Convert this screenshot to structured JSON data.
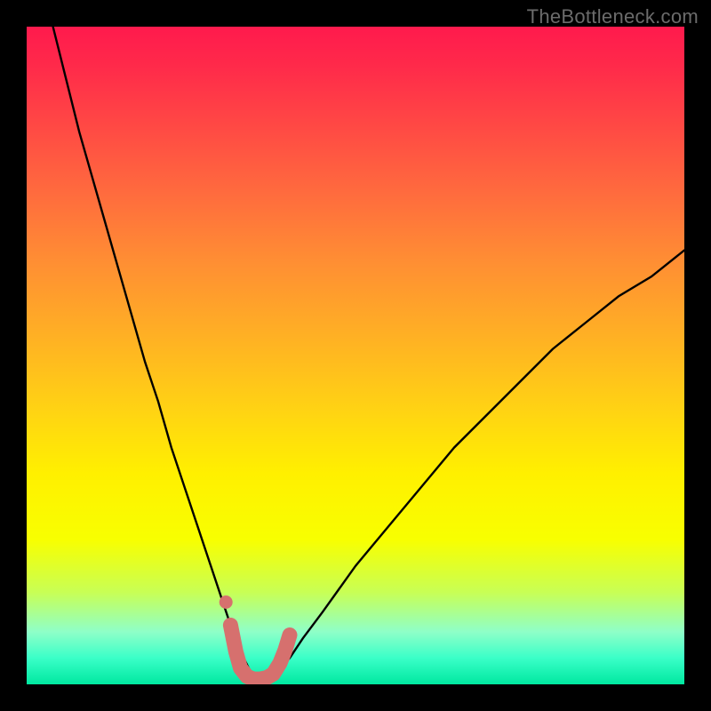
{
  "watermark": {
    "text": "TheBottleneck.com"
  },
  "palette": {
    "curve": "#000000",
    "marker": "#d6706e",
    "frame": "#000000"
  },
  "chart_data": {
    "type": "line",
    "title": "",
    "xlabel": "",
    "ylabel": "",
    "xlim": [
      0,
      100
    ],
    "ylim": [
      0,
      100
    ],
    "grid": false,
    "legend": false,
    "annotations": [
      "TheBottleneck.com"
    ],
    "series": [
      {
        "name": "bottleneck-curve",
        "x": [
          4,
          6,
          8,
          10,
          12,
          14,
          16,
          18,
          20,
          22,
          24,
          26,
          28,
          30,
          31,
          32,
          33,
          34,
          35,
          36,
          37,
          38,
          40,
          42,
          45,
          50,
          55,
          60,
          65,
          70,
          75,
          80,
          85,
          90,
          95,
          100
        ],
        "y": [
          100,
          92,
          84,
          77,
          70,
          63,
          56,
          49,
          43,
          36,
          30,
          24,
          18,
          12,
          9,
          6,
          4,
          2,
          1,
          1,
          1,
          2,
          4,
          7,
          11,
          18,
          24,
          30,
          36,
          41,
          46,
          51,
          55,
          59,
          62,
          66
        ]
      }
    ],
    "markers": {
      "name": "valley-highlight",
      "color": "#d6706e",
      "points": [
        {
          "x": 31.0,
          "y": 9
        },
        {
          "x": 31.8,
          "y": 5
        },
        {
          "x": 32.5,
          "y": 2.5
        },
        {
          "x": 33.5,
          "y": 1.2
        },
        {
          "x": 34.5,
          "y": 0.8
        },
        {
          "x": 35.5,
          "y": 0.8
        },
        {
          "x": 36.5,
          "y": 1.0
        },
        {
          "x": 37.5,
          "y": 1.6
        },
        {
          "x": 38.5,
          "y": 3.2
        },
        {
          "x": 39.3,
          "y": 5.2
        },
        {
          "x": 40.0,
          "y": 7.5
        }
      ]
    }
  }
}
